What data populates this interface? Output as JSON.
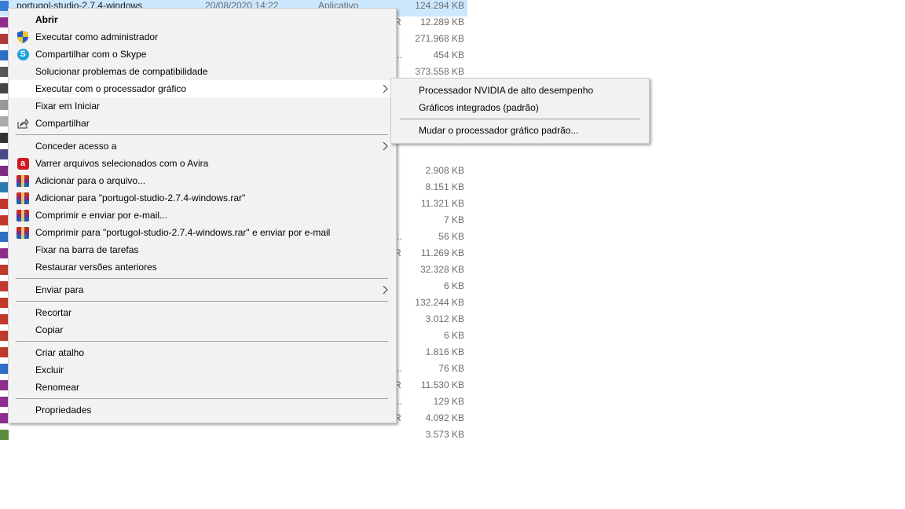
{
  "explorer": {
    "selected_file": {
      "name": "portugol-studio-2.7.4-windows",
      "date": "20/08/2020 14:22",
      "type": "Aplicativo",
      "size": "124.294 KB"
    },
    "rows": [
      {
        "frag": "R",
        "size": "12.289 KB"
      },
      {
        "frag": "",
        "size": "271.968 KB"
      },
      {
        "frag": "...",
        "size": "454 KB"
      },
      {
        "frag": "",
        "size": "373.558 KB"
      },
      {
        "frag": "",
        "size": ""
      },
      {
        "frag": "",
        "size": ""
      },
      {
        "frag": "",
        "size": ""
      },
      {
        "frag": "",
        "size": ""
      },
      {
        "frag": "",
        "size": ""
      },
      {
        "frag": "",
        "size": "2.908 KB"
      },
      {
        "frag": "",
        "size": "8.151 KB"
      },
      {
        "frag": "",
        "size": "11.321 KB"
      },
      {
        "frag": "",
        "size": "7 KB"
      },
      {
        "frag": "...",
        "size": "56 KB"
      },
      {
        "frag": "R",
        "size": "11.269 KB"
      },
      {
        "frag": "",
        "size": "32.328 KB"
      },
      {
        "frag": "",
        "size": "6 KB"
      },
      {
        "frag": "",
        "size": "132.244 KB"
      },
      {
        "frag": "",
        "size": "3.012 KB"
      },
      {
        "frag": "",
        "size": "6 KB"
      },
      {
        "frag": "",
        "size": "1.816 KB"
      },
      {
        "frag": "...",
        "size": "76 KB"
      },
      {
        "frag": "R",
        "size": "11.530 KB"
      },
      {
        "frag": "...",
        "size": "129 KB"
      },
      {
        "frag": "R",
        "size": "4.092 KB"
      },
      {
        "frag": "",
        "size": "3.573 KB"
      }
    ]
  },
  "context_menu": {
    "open": "Abrir",
    "run_as_admin": "Executar como administrador",
    "share_skype": "Compartilhar com o Skype",
    "troubleshoot": "Solucionar problemas de compatibilidade",
    "run_with_gpu": "Executar com o processador gráfico",
    "pin_start": "Fixar em Iniciar",
    "share": "Compartilhar",
    "grant_access": "Conceder acesso a",
    "avira_scan": "Varrer arquivos selecionados com o Avira",
    "add_to_archive": "Adicionar para o arquivo...",
    "add_to_rar": "Adicionar para \"portugol-studio-2.7.4-windows.rar\"",
    "compress_email": "Comprimir e enviar por e-mail...",
    "compress_rar_email": "Comprimir para \"portugol-studio-2.7.4-windows.rar\" e enviar por e-mail",
    "pin_taskbar": "Fixar na barra de tarefas",
    "restore_versions": "Restaurar versões anteriores",
    "send_to": "Enviar para",
    "cut": "Recortar",
    "copy": "Copiar",
    "create_shortcut": "Criar atalho",
    "delete": "Excluir",
    "rename": "Renomear",
    "properties": "Propriedades"
  },
  "gpu_submenu": {
    "nvidia": "Processador NVIDIA de alto desempenho",
    "integrated": "Gráficos integrados (padrão)",
    "change_default": "Mudar o processador gráfico padrão..."
  },
  "icons": {
    "uac_shield": "shield-icon",
    "skype": "skype-icon",
    "troubleshoot": "compatibility-icon",
    "share": "share-icon",
    "avira": "avira-icon",
    "winrar": "winrar-icon",
    "submenu_arrow": "chevron-right-icon"
  },
  "colors": {
    "menu_bg": "#f2f2f2",
    "menu_highlight": "#ffffff",
    "selection_bg": "#cce8ff",
    "separator": "#a0a0a0"
  }
}
